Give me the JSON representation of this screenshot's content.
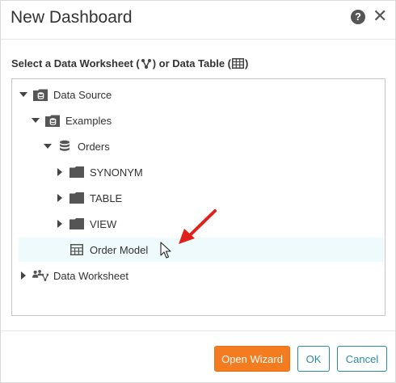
{
  "dialog": {
    "title": "New Dashboard",
    "help_icon": "question-circle-icon",
    "close_icon": "close-icon"
  },
  "prompt": {
    "part1": "Select a Data Worksheet (",
    "part2": ") or Data Table (",
    "part3": ")"
  },
  "tree": {
    "items": [
      {
        "label": "Data Source",
        "icon": "database-folder-icon",
        "expanded": true
      },
      {
        "label": "Examples",
        "icon": "database-folder-icon",
        "expanded": true
      },
      {
        "label": "Orders",
        "icon": "database-icon",
        "expanded": true
      },
      {
        "label": "SYNONYM",
        "icon": "folder-icon",
        "expanded": false
      },
      {
        "label": "TABLE",
        "icon": "folder-icon",
        "expanded": false
      },
      {
        "label": "VIEW",
        "icon": "folder-icon",
        "expanded": false
      },
      {
        "label": "Order Model",
        "icon": "table-icon",
        "selected": true
      },
      {
        "label": "Data Worksheet",
        "icon": "worksheet-people-icon",
        "expanded": false
      }
    ]
  },
  "footer": {
    "open_wizard": "Open Wizard",
    "ok": "OK",
    "cancel": "Cancel"
  },
  "colors": {
    "primary": "#f47c20",
    "secondary_border": "#2a8a9e",
    "selected_row": "#eefafb",
    "annotation_arrow": "#e0201b"
  }
}
